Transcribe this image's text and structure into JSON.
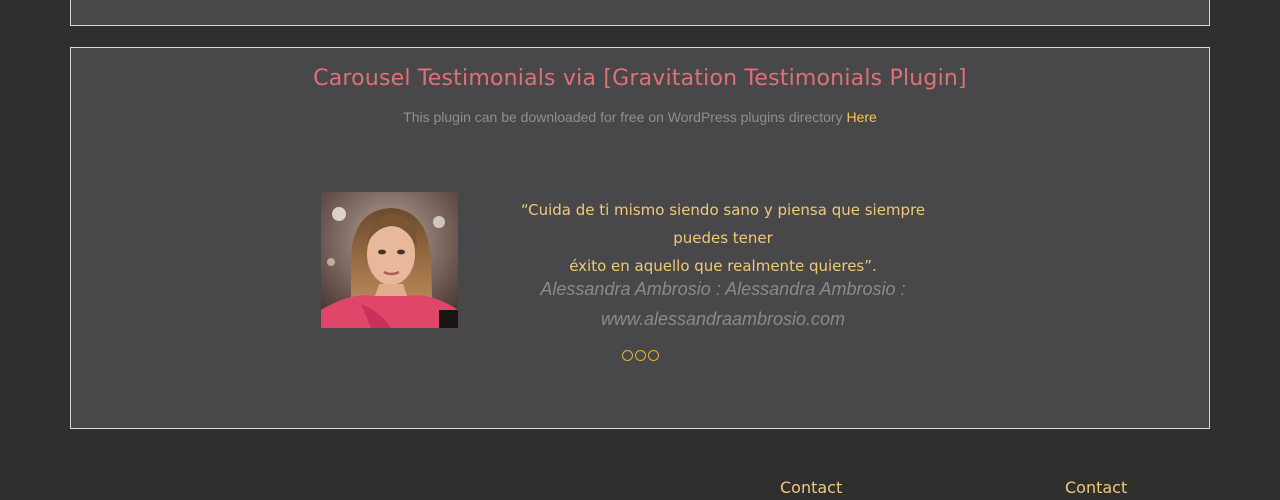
{
  "section": {
    "title": "Carousel Testimonials via [Gravitation Testimonials Plugin]",
    "subtitle_text": "This plugin can be downloaded for free on WordPress plugins directory ",
    "subtitle_link": "Here"
  },
  "testimonial": {
    "quote_line1": "“Cuida de ti mismo siendo sano y piensa que siempre puedes tener",
    "quote_line2": "éxito en aquello que realmente quieres”.",
    "author_line1": "Alessandra Ambrosio : Alessandra Ambrosio :",
    "author_line2": "www.alessandraambrosio.com"
  },
  "carousel": {
    "dot_count": 3
  },
  "footer": {
    "contact_1": "Contact",
    "contact_2": "Contact"
  },
  "colors": {
    "background": "#2f2f2f",
    "panel": "#48484a",
    "title": "#e17076",
    "accent": "#f5c65a",
    "quote": "#f2c878",
    "muted": "#8f8f8f"
  }
}
